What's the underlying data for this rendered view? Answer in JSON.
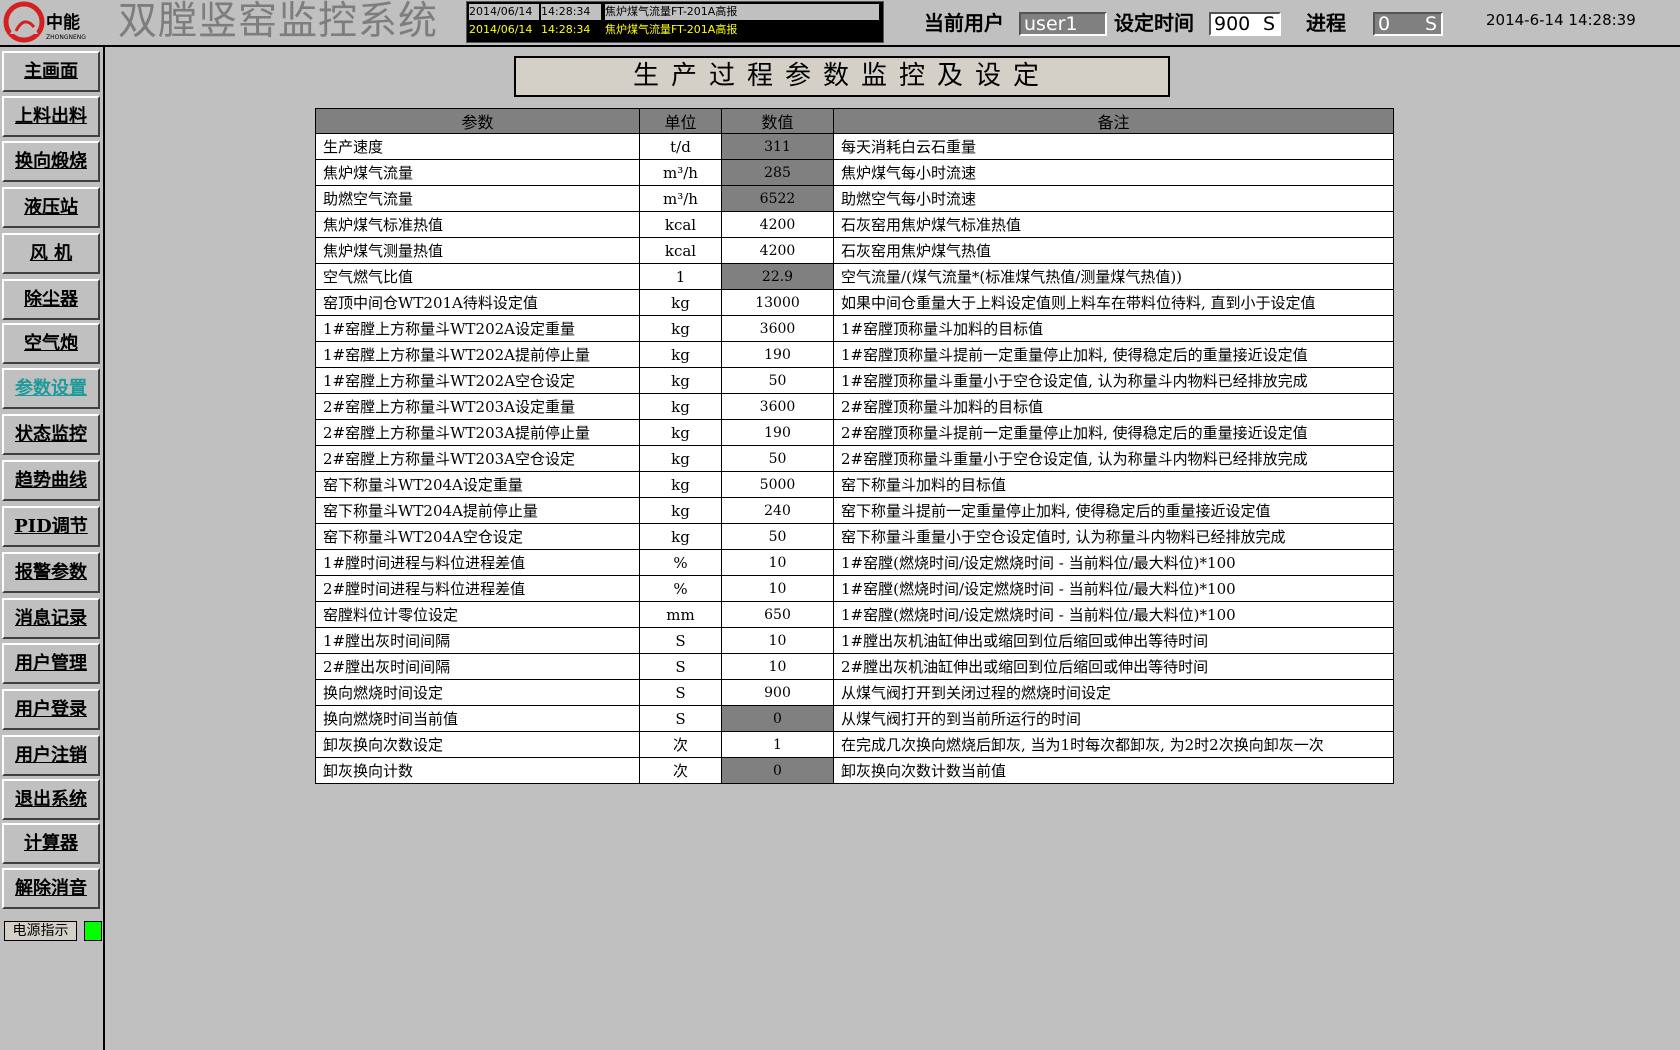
{
  "header": {
    "logo_text": "中能",
    "logo_subtext": "ZHONGNENG",
    "app_title": "双膛竖窑监控系统",
    "alarms": [
      {
        "date": "2014/06/14",
        "time": "14:28:34",
        "message": "焦炉煤气流量FT-201A高报"
      },
      {
        "date": "2014/06/14",
        "time": "14:28:34",
        "message": "焦炉煤气流量FT-201A高报"
      }
    ],
    "current_user_label": "当前用户",
    "current_user_value": "user1",
    "set_time_label": "设定时间",
    "set_time_value": "900",
    "set_time_unit": "S",
    "progress_label": "进程",
    "progress_value": "0",
    "progress_unit": "S",
    "datetime": "2014-6-14 14:28:39"
  },
  "sidebar": {
    "items": [
      {
        "label": "主画面"
      },
      {
        "label": "上料出料"
      },
      {
        "label": "换向煅烧"
      },
      {
        "label": "液压站"
      },
      {
        "label": "风 机"
      },
      {
        "label": "除尘器"
      },
      {
        "label": "空气炮"
      },
      {
        "label": "参数设置",
        "active": true
      },
      {
        "label": "状态监控"
      },
      {
        "label": "趋势曲线"
      },
      {
        "label": "PID调节"
      },
      {
        "label": "报警参数"
      },
      {
        "label": "消息记录"
      },
      {
        "label": "用户管理"
      },
      {
        "label": "用户登录"
      },
      {
        "label": "用户注销"
      },
      {
        "label": "退出系统"
      },
      {
        "label": "计算器"
      },
      {
        "label": "解除消音"
      }
    ],
    "power_label": "电源指示",
    "power_color": "#00ff00"
  },
  "main": {
    "title": "生产过程参数监控及设定",
    "columns": [
      "参数",
      "单位",
      "数值",
      "备注"
    ],
    "rows": [
      {
        "name": "生产速度",
        "unit": "t/d",
        "value": "311",
        "note": "每天消耗白云石重量",
        "readonly": true
      },
      {
        "name": "焦炉煤气流量",
        "unit": "m³/h",
        "value": "285",
        "note": "焦炉煤气每小时流速",
        "readonly": true
      },
      {
        "name": "助燃空气流量",
        "unit": "m³/h",
        "value": "6522",
        "note": "助燃空气每小时流速",
        "readonly": true
      },
      {
        "name": "焦炉煤气标准热值",
        "unit": "kcal",
        "value": "4200",
        "note": "石灰窑用焦炉煤气标准热值",
        "readonly": false
      },
      {
        "name": "焦炉煤气测量热值",
        "unit": "kcal",
        "value": "4200",
        "note": "石灰窑用焦炉煤气热值",
        "readonly": false
      },
      {
        "name": "空气燃气比值",
        "unit": "1",
        "value": "22.9",
        "note": "空气流量/(煤气流量*(标准煤气热值/测量煤气热值))",
        "readonly": true
      },
      {
        "name": "窑顶中间仓WT201A待料设定值",
        "unit": "kg",
        "value": "13000",
        "note": "如果中间仓重量大于上料设定值则上料车在带料位待料, 直到小于设定值",
        "readonly": false
      },
      {
        "name": "1#窑膛上方称量斗WT202A设定重量",
        "unit": "kg",
        "value": "3600",
        "note": "1#窑膛顶称量斗加料的目标值",
        "readonly": false
      },
      {
        "name": "1#窑膛上方称量斗WT202A提前停止量",
        "unit": "kg",
        "value": "190",
        "note": "1#窑膛顶称量斗提前一定重量停止加料, 使得稳定后的重量接近设定值",
        "readonly": false
      },
      {
        "name": "1#窑膛上方称量斗WT202A空仓设定",
        "unit": "kg",
        "value": "50",
        "note": "1#窑膛顶称量斗重量小于空仓设定值, 认为称量斗内物料已经排放完成",
        "readonly": false
      },
      {
        "name": "2#窑膛上方称量斗WT203A设定重量",
        "unit": "kg",
        "value": "3600",
        "note": "2#窑膛顶称量斗加料的目标值",
        "readonly": false
      },
      {
        "name": "2#窑膛上方称量斗WT203A提前停止量",
        "unit": "kg",
        "value": "190",
        "note": "2#窑膛顶称量斗提前一定重量停止加料, 使得稳定后的重量接近设定值",
        "readonly": false
      },
      {
        "name": "2#窑膛上方称量斗WT203A空仓设定",
        "unit": "kg",
        "value": "50",
        "note": "2#窑膛顶称量斗重量小于空仓设定值, 认为称量斗内物料已经排放完成",
        "readonly": false
      },
      {
        "name": "窑下称量斗WT204A设定重量",
        "unit": "kg",
        "value": "5000",
        "note": "窑下称量斗加料的目标值",
        "readonly": false
      },
      {
        "name": "窑下称量斗WT204A提前停止量",
        "unit": "kg",
        "value": "240",
        "note": "窑下称量斗提前一定重量停止加料, 使得稳定后的重量接近设定值",
        "readonly": false
      },
      {
        "name": "窑下称量斗WT204A空仓设定",
        "unit": "kg",
        "value": "50",
        "note": "窑下称量斗重量小于空仓设定值时, 认为称量斗内物料已经排放完成",
        "readonly": false
      },
      {
        "name": "1#膛时间进程与料位进程差值",
        "unit": "%",
        "value": "10",
        "note": "1#窑膛(燃烧时间/设定燃烧时间 - 当前料位/最大料位)*100",
        "readonly": false
      },
      {
        "name": "2#膛时间进程与料位进程差值",
        "unit": "%",
        "value": "10",
        "note": "1#窑膛(燃烧时间/设定燃烧时间 - 当前料位/最大料位)*100",
        "readonly": false
      },
      {
        "name": "窑膛料位计零位设定",
        "unit": "mm",
        "value": "650",
        "note": "1#窑膛(燃烧时间/设定燃烧时间 - 当前料位/最大料位)*100",
        "readonly": false
      },
      {
        "name": "1#膛出灰时间间隔",
        "unit": "S",
        "value": "10",
        "note": "1#膛出灰机油缸伸出或缩回到位后缩回或伸出等待时间",
        "readonly": false
      },
      {
        "name": "2#膛出灰时间间隔",
        "unit": "S",
        "value": "10",
        "note": "2#膛出灰机油缸伸出或缩回到位后缩回或伸出等待时间",
        "readonly": false
      },
      {
        "name": "换向燃烧时间设定",
        "unit": "S",
        "value": "900",
        "note": "从煤气阀打开到关闭过程的燃烧时间设定",
        "readonly": false
      },
      {
        "name": "换向燃烧时间当前值",
        "unit": "S",
        "value": "0",
        "note": "从煤气阀打开的到当前所运行的时间",
        "readonly": true
      },
      {
        "name": "卸灰换向次数设定",
        "unit": "次",
        "value": "1",
        "note": "在完成几次换向燃烧后卸灰, 当为1时每次都卸灰, 为2时2次换向卸灰一次",
        "readonly": false
      },
      {
        "name": "卸灰换向计数",
        "unit": "次",
        "value": "0",
        "note": "卸灰换向次数计数当前值",
        "readonly": true
      }
    ]
  },
  "colors": {
    "background": "#c0c0c0",
    "readonly_cell": "#808080",
    "alarm_text": "#ffff00",
    "active_nav": "#1f9a9a",
    "logo_red": "#d42020"
  }
}
